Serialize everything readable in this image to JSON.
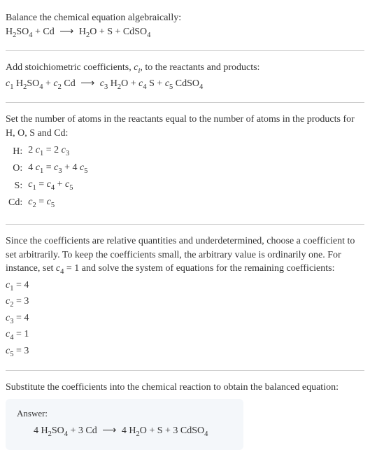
{
  "intro": {
    "line1": "Balance the chemical equation algebraically:",
    "eq_html": "H<span class='sub'>2</span>SO<span class='sub'>4</span> + Cd <span class='arrow'>⟶</span> H<span class='sub'>2</span>O + S + CdSO<span class='sub'>4</span>"
  },
  "stoich": {
    "line1_html": "Add stoichiometric coefficients, <span class='italic'>c<span class=\"sub\">i</span></span>, to the reactants and products:",
    "eq_html": "<span class='italic'>c</span><span class='sub'>1</span> H<span class='sub'>2</span>SO<span class='sub'>4</span> + <span class='italic'>c</span><span class='sub'>2</span> Cd <span class='arrow'>⟶</span> <span class='italic'>c</span><span class='sub'>3</span> H<span class='sub'>2</span>O + <span class='italic'>c</span><span class='sub'>4</span> S + <span class='italic'>c</span><span class='sub'>5</span> CdSO<span class='sub'>4</span>"
  },
  "atoms": {
    "intro": "Set the number of atoms in the reactants equal to the number of atoms in the products for H, O, S and Cd:",
    "rows": [
      {
        "label": "H:",
        "eq_html": "2 <span class='italic'>c</span><span class='sub'>1</span> = 2 <span class='italic'>c</span><span class='sub'>3</span>"
      },
      {
        "label": "O:",
        "eq_html": "4 <span class='italic'>c</span><span class='sub'>1</span> = <span class='italic'>c</span><span class='sub'>3</span> + 4 <span class='italic'>c</span><span class='sub'>5</span>"
      },
      {
        "label": "S:",
        "eq_html": "<span class='italic'>c</span><span class='sub'>1</span> = <span class='italic'>c</span><span class='sub'>4</span> + <span class='italic'>c</span><span class='sub'>5</span>"
      },
      {
        "label": "Cd:",
        "eq_html": "<span class='italic'>c</span><span class='sub'>2</span> = <span class='italic'>c</span><span class='sub'>5</span>"
      }
    ]
  },
  "solve": {
    "intro_html": "Since the coefficients are relative quantities and underdetermined, choose a coefficient to set arbitrarily. To keep the coefficients small, the arbitrary value is ordinarily one. For instance, set <span class='italic'>c</span><span class='sub'>4</span> = 1 and solve the system of equations for the remaining coefficients:",
    "lines_html": [
      "<span class='italic'>c</span><span class='sub'>1</span> = 4",
      "<span class='italic'>c</span><span class='sub'>2</span> = 3",
      "<span class='italic'>c</span><span class='sub'>3</span> = 4",
      "<span class='italic'>c</span><span class='sub'>4</span> = 1",
      "<span class='italic'>c</span><span class='sub'>5</span> = 3"
    ]
  },
  "final": {
    "intro": "Substitute the coefficients into the chemical reaction to obtain the balanced equation:",
    "answer_label": "Answer:",
    "answer_eq_html": "4 H<span class='sub'>2</span>SO<span class='sub'>4</span> + 3 Cd <span class='arrow'>⟶</span> 4 H<span class='sub'>2</span>O + S + 3 CdSO<span class='sub'>4</span>"
  }
}
